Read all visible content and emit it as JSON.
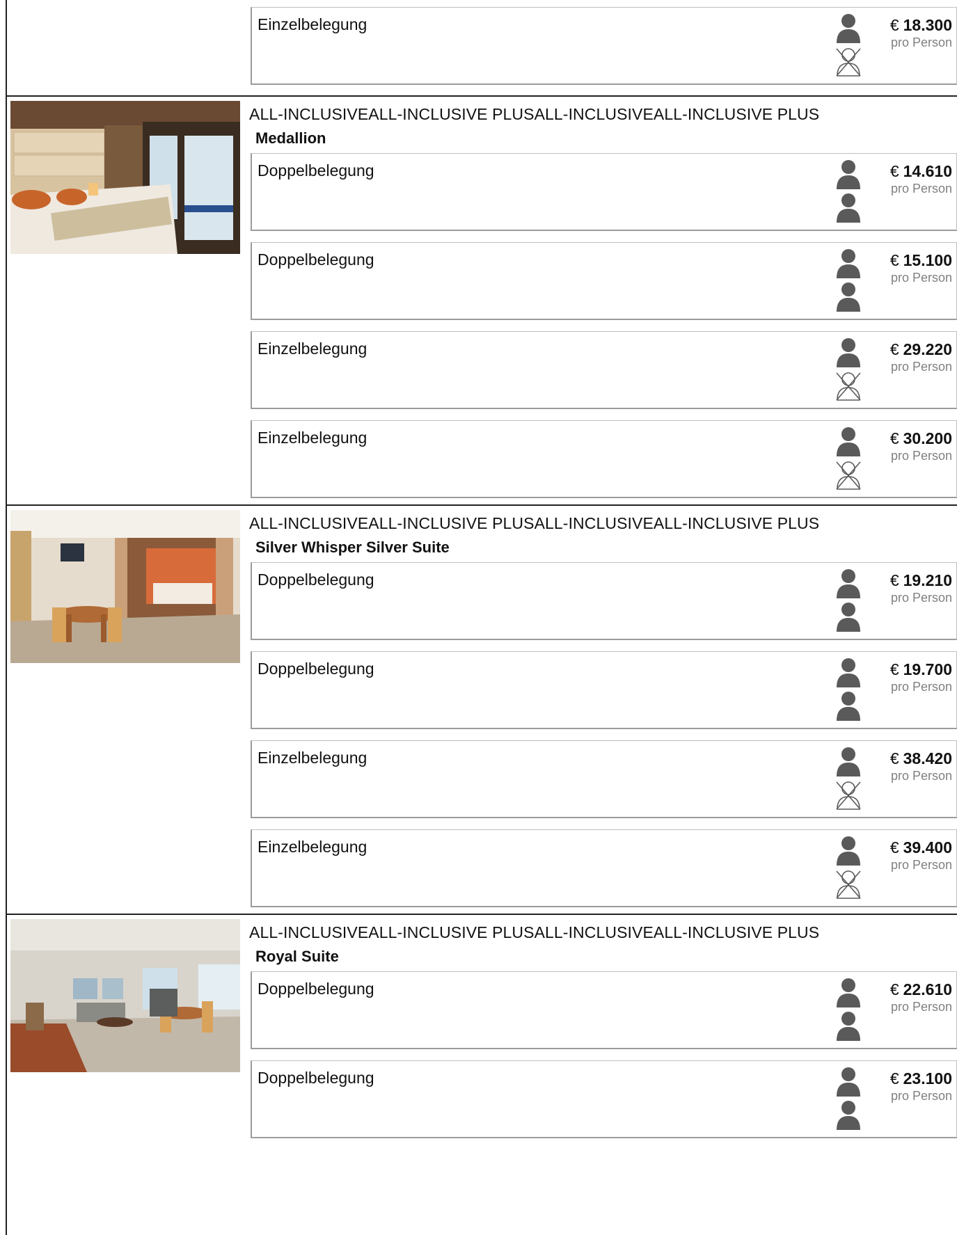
{
  "person_icon_color": "#5a5a5a",
  "top_card": {
    "occupancy": "Einzelbelegung",
    "persons": 1,
    "currency": "€",
    "price": "18.300",
    "per": "pro Person"
  },
  "cabins": [
    {
      "tags": "ALL-INCLUSIVEALL-INCLUSIVE PLUSALL-INCLUSIVEALL-INCLUSIVE PLUS",
      "name": "Medallion",
      "image": "bedroom-balcony-photo",
      "offers": [
        {
          "occupancy": "Doppelbelegung",
          "persons": 2,
          "currency": "€",
          "price": "14.610",
          "per": "pro Person"
        },
        {
          "occupancy": "Doppelbelegung",
          "persons": 2,
          "currency": "€",
          "price": "15.100",
          "per": "pro Person"
        },
        {
          "occupancy": "Einzelbelegung",
          "persons": 1,
          "currency": "€",
          "price": "29.220",
          "per": "pro Person"
        },
        {
          "occupancy": "Einzelbelegung",
          "persons": 1,
          "currency": "€",
          "price": "30.200",
          "per": "pro Person"
        }
      ]
    },
    {
      "tags": "ALL-INCLUSIVEALL-INCLUSIVE PLUSALL-INCLUSIVEALL-INCLUSIVE PLUS",
      "name": "Silver Whisper Silver Suite",
      "image": "suite-dining-photo",
      "offers": [
        {
          "occupancy": "Doppelbelegung",
          "persons": 2,
          "currency": "€",
          "price": "19.210",
          "per": "pro Person"
        },
        {
          "occupancy": "Doppelbelegung",
          "persons": 2,
          "currency": "€",
          "price": "19.700",
          "per": "pro Person"
        },
        {
          "occupancy": "Einzelbelegung",
          "persons": 1,
          "currency": "€",
          "price": "38.420",
          "per": "pro Person"
        },
        {
          "occupancy": "Einzelbelegung",
          "persons": 1,
          "currency": "€",
          "price": "39.400",
          "per": "pro Person"
        }
      ]
    },
    {
      "tags": "ALL-INCLUSIVEALL-INCLUSIVE PLUSALL-INCLUSIVEALL-INCLUSIVE PLUS",
      "name": "Royal Suite",
      "image": "royal-suite-living-photo",
      "offers": [
        {
          "occupancy": "Doppelbelegung",
          "persons": 2,
          "currency": "€",
          "price": "22.610",
          "per": "pro Person"
        },
        {
          "occupancy": "Doppelbelegung",
          "persons": 2,
          "currency": "€",
          "price": "23.100",
          "per": "pro Person"
        }
      ]
    }
  ]
}
